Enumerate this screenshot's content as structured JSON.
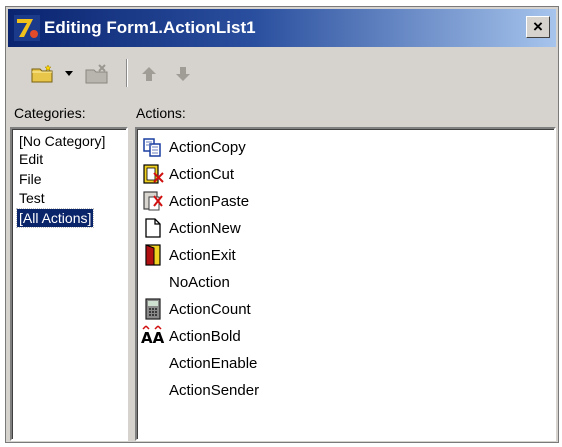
{
  "window": {
    "title": "Editing Form1.ActionList1",
    "close_label": "×"
  },
  "toolbar": {
    "buttons": [
      {
        "name": "new-action-button",
        "icon": "folder-new-icon"
      },
      {
        "name": "new-action-dropdown",
        "icon": "chevron-down-icon"
      },
      {
        "name": "delete-action-button",
        "icon": "delete-icon"
      },
      {
        "name": "move-up-button",
        "icon": "arrow-up-icon"
      },
      {
        "name": "move-down-button",
        "icon": "arrow-down-icon"
      }
    ]
  },
  "categories": {
    "label": "Categories:",
    "items": [
      "[No Category]",
      "Edit",
      "File",
      "Test",
      "[All Actions]"
    ],
    "selected": "[All Actions]"
  },
  "actions": {
    "label": "Actions:",
    "items": [
      {
        "label": "ActionCopy",
        "icon": "copy-icon"
      },
      {
        "label": "ActionCut",
        "icon": "cut-icon"
      },
      {
        "label": "ActionPaste",
        "icon": "paste-icon"
      },
      {
        "label": "ActionNew",
        "icon": "new-document-icon"
      },
      {
        "label": "ActionExit",
        "icon": "exit-door-icon"
      },
      {
        "label": "NoAction",
        "icon": ""
      },
      {
        "label": "ActionCount",
        "icon": "calculator-icon"
      },
      {
        "label": "ActionBold",
        "icon": "bold-icon"
      },
      {
        "label": "ActionEnable",
        "icon": ""
      },
      {
        "label": "ActionSender",
        "icon": ""
      }
    ]
  },
  "colors": {
    "title_start": "#0a2470",
    "title_end": "#a6c4ec",
    "selection": "#0a246a",
    "face": "#d6d3ce"
  }
}
